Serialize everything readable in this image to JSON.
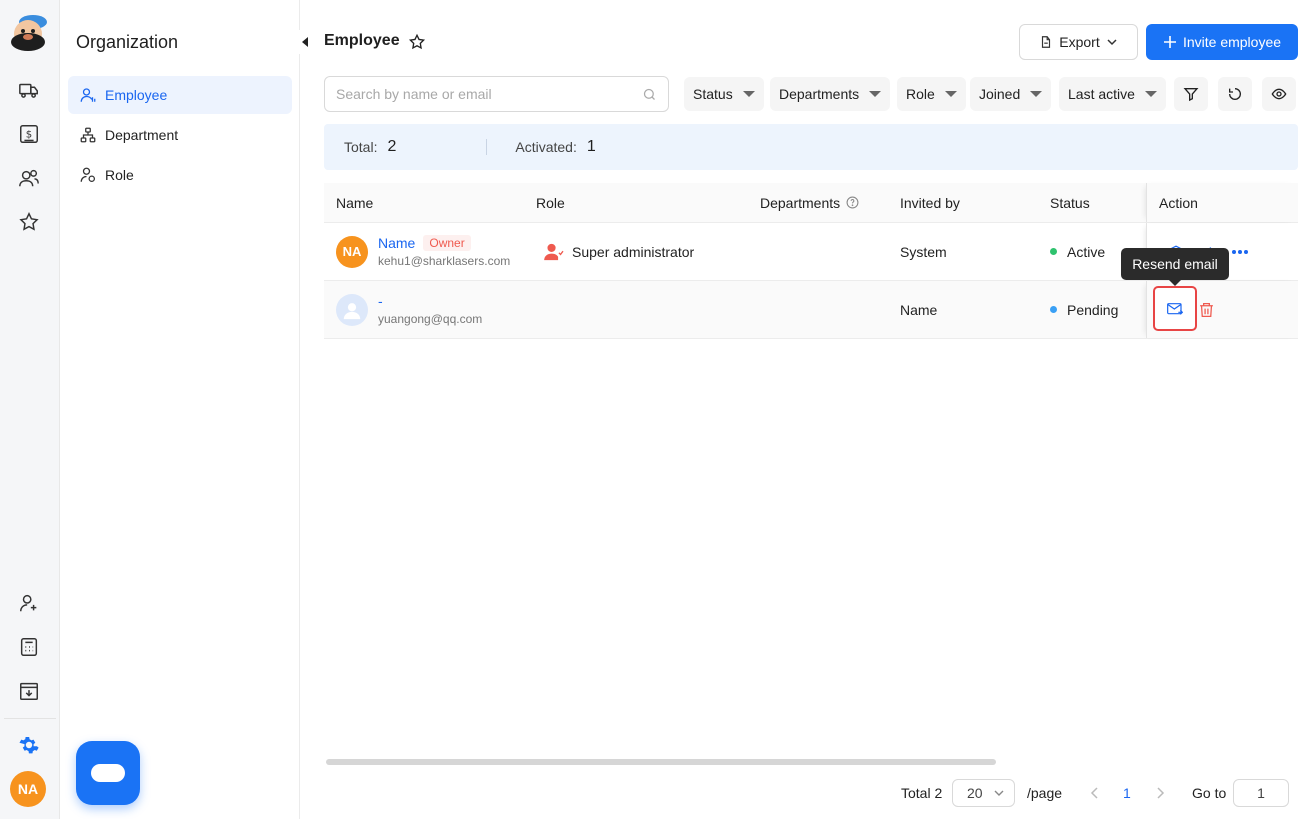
{
  "nav": {
    "title": "Organization",
    "items": [
      {
        "label": "Employee",
        "icon": "user-icon",
        "active": true
      },
      {
        "label": "Department",
        "icon": "org-chart-icon",
        "active": false
      },
      {
        "label": "Role",
        "icon": "user-role-icon",
        "active": false
      }
    ]
  },
  "rail": {
    "avatar_initials": "NA",
    "accent": "#1a73f5"
  },
  "header": {
    "title": "Employee",
    "export_label": "Export",
    "invite_label": "Invite employee"
  },
  "toolbar": {
    "search_placeholder": "Search by name or email",
    "filters": [
      "Status",
      "Departments",
      "Role",
      "Joined",
      "Last active"
    ]
  },
  "summary": {
    "total_label": "Total:",
    "total_value": "2",
    "activated_label": "Activated:",
    "activated_value": "1"
  },
  "table": {
    "columns": {
      "name": "Name",
      "role": "Role",
      "departments": "Departments",
      "invited_by": "Invited by",
      "status": "Status",
      "action": "Action"
    },
    "rows": [
      {
        "avatar_initials": "NA",
        "name": "Name",
        "tag": "Owner",
        "email": "kehu1@sharklasers.com",
        "role": "Super administrator",
        "departments": "",
        "invited_by": "System",
        "status": "Active",
        "status_color": "#2fc26e"
      },
      {
        "avatar_initials": "",
        "name": "-",
        "tag": "",
        "email": "yuangong@qq.com",
        "role": "",
        "departments": "",
        "invited_by": "Name",
        "status": "Pending",
        "status_color": "#3aa0f5"
      }
    ]
  },
  "tooltip": {
    "text": "Resend email"
  },
  "pagination": {
    "total_text": "Total 2",
    "page_size": "20",
    "per_page_text": "/page",
    "current_page": "1",
    "goto_label": "Go to",
    "goto_value": "1"
  }
}
